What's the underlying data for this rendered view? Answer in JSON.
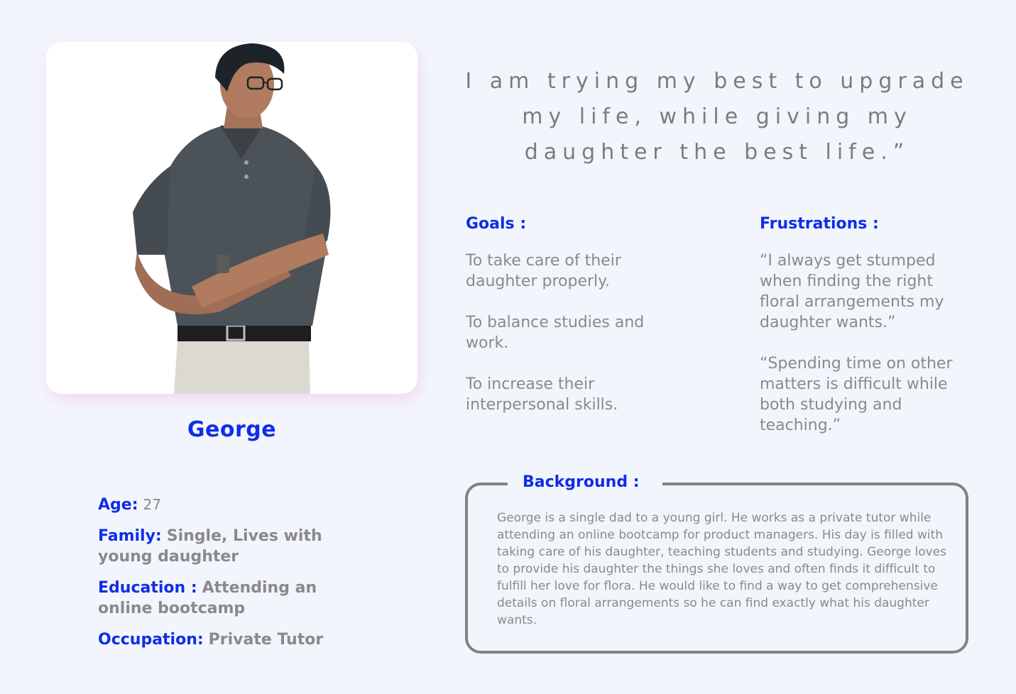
{
  "persona": {
    "name": "George",
    "details": [
      {
        "label": "Age:",
        "value": "27"
      },
      {
        "label": "Family:",
        "value": "Single, Lives with young daughter"
      },
      {
        "label": "Education :",
        "value": "Attending an online bootcamp"
      },
      {
        "label": "Occupation:",
        "value": "Private Tutor"
      }
    ]
  },
  "quote": "I am trying my best to upgrade my life, while giving my daughter the best life.”",
  "goals": {
    "heading": "Goals :",
    "items": [
      "To take care of their daughter properly.",
      "To balance studies and work.",
      "To increase their interpersonal skills."
    ]
  },
  "frustrations": {
    "heading": "Frustrations :",
    "items": [
      "“I always get stumped when finding the right floral arrangements my daughter wants.”",
      "“Spending time on other matters is difficult while both studying and teaching.”"
    ]
  },
  "background": {
    "heading": "Background :",
    "text": "George is a single dad to a young girl. He works as a private tutor while attending an online bootcamp for product managers. His day is filled with taking care of his daughter, teaching students and studying. George loves to provide his daughter the things she loves and often finds it difficult to fulfill her love for flora. He would like to find a way to get comprehensive details on floral arrangements so he can find exactly what his daughter wants."
  },
  "colors": {
    "accent": "#0f2ee6",
    "text": "#8a8a8a",
    "page_bg": "#f3f5fd",
    "border": "#828282"
  }
}
